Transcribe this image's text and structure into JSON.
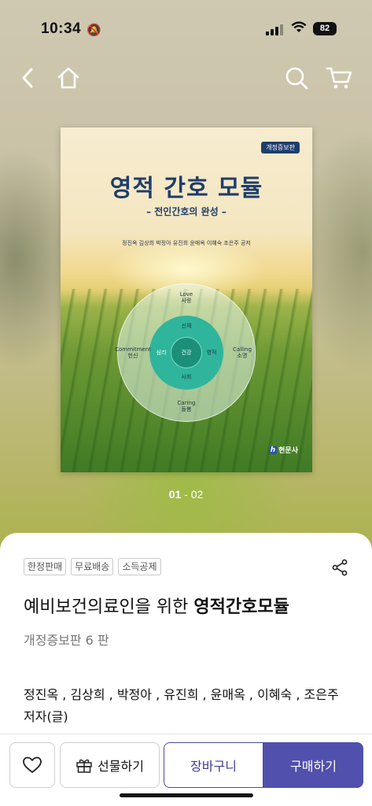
{
  "status": {
    "time": "10:34",
    "battery": "82"
  },
  "cover": {
    "badge": "개정증보판",
    "title": "영적 간호 모듈",
    "subtitle": "– 전인간호의 완성 –",
    "authors": "정진옥 김상희 박정아 유진희 윤매옥 이혜숙 조은주 공저",
    "diagram": {
      "top": "Love\n사랑",
      "left": "Commitment\n헌신",
      "right": "Calling\n소명",
      "bottom": "Caring\n돌봄",
      "mid_top": "신체",
      "mid_left": "심리",
      "mid_right": "영적",
      "mid_bottom": "사회",
      "center": "건강"
    },
    "publisher_logo": "h",
    "publisher": "현문사"
  },
  "pager": {
    "current": "01",
    "separator": " - ",
    "total": "02"
  },
  "product": {
    "tags": [
      "한정판매",
      "무료배송",
      "소득공제"
    ],
    "title_prefix": "예비보건의료인을 위한 ",
    "title_main": "영적간호모듈",
    "edition": "개정증보판 6 판",
    "authors": "정진옥 , 김상희 , 박정아 , 유진희 , 윤매옥 , 이혜숙 , 조은주",
    "author_role": "저자(글)"
  },
  "actions": {
    "gift": "선물하기",
    "cart": "장바구니",
    "buy": "구매하기"
  },
  "colors": {
    "accent": "#5150ad",
    "cover_title": "#1f3d6b",
    "circle_teal": "#2fb59c"
  }
}
